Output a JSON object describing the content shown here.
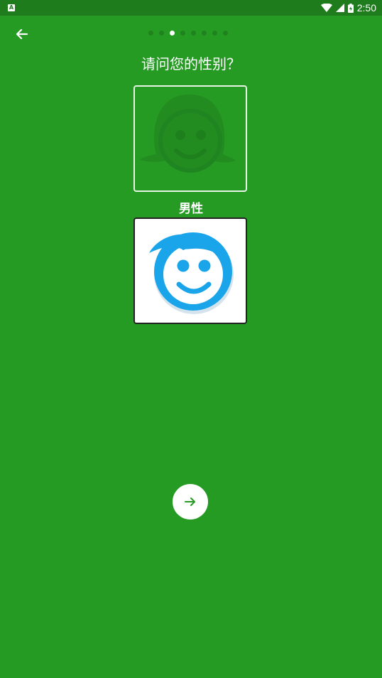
{
  "status_bar": {
    "left_icon": "A",
    "icons": [
      "wifi-icon",
      "cell-signal-icon",
      "battery-icon"
    ],
    "time": "2:50"
  },
  "nav": {
    "back_icon": "arrow-left-icon",
    "page_dots": {
      "total": 8,
      "active_index": 2
    }
  },
  "question": "请问您的性别？",
  "options": [
    {
      "id": "female",
      "icon": "female-face-icon",
      "selected": false
    },
    {
      "id": "male",
      "label": "男性",
      "icon": "male-face-icon",
      "selected": true
    }
  ],
  "next_button": {
    "icon": "arrow-right-icon"
  },
  "colors": {
    "background": "#269b24",
    "status_bar": "#1e7c1c",
    "male_face": "#1aa5ea",
    "female_face": "#228c21"
  }
}
